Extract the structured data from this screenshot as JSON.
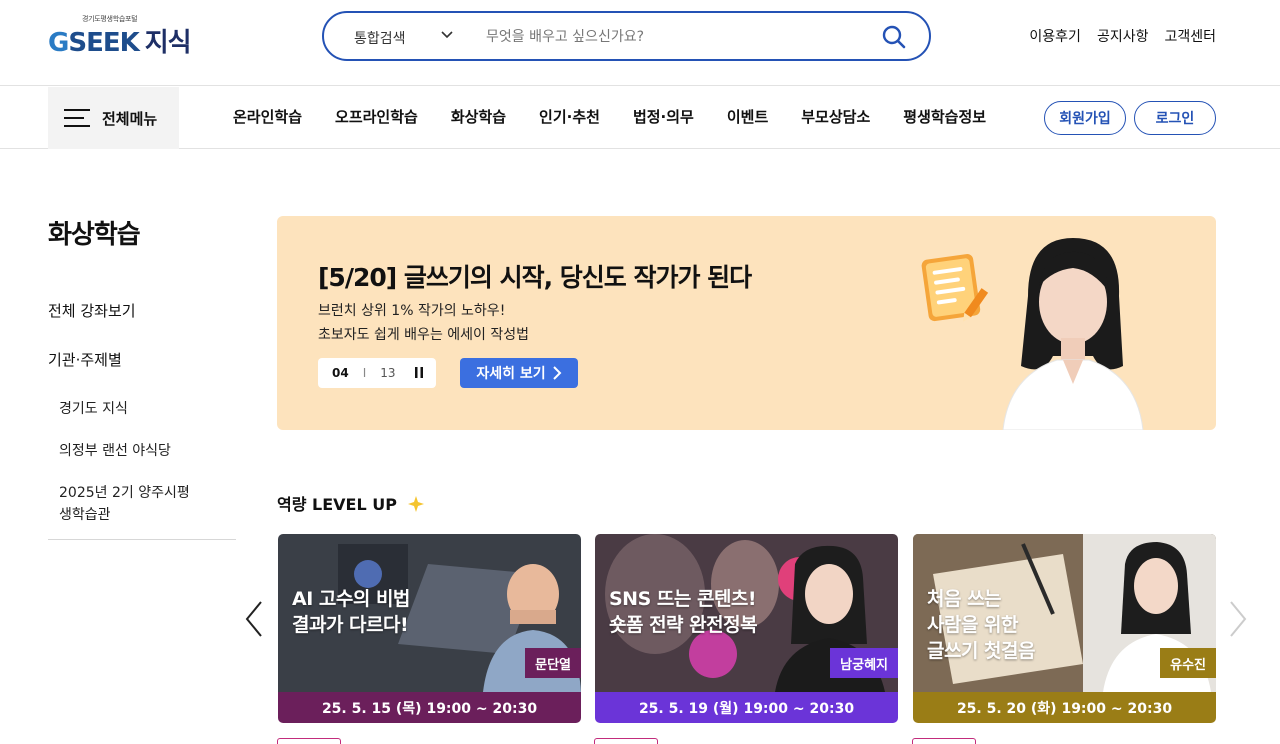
{
  "header": {
    "logo_tagline": "경기도평생학습포털",
    "logo_g": "G",
    "logo_seek": "SEEK",
    "logo_jisik": "지식",
    "search_scope": "통합검색",
    "search_placeholder": "무엇을 배우고 싶으신가요?",
    "utils": [
      "이용후기",
      "공지사항",
      "고객센터"
    ]
  },
  "nav": {
    "all_menu_label": "전체메뉴",
    "items": [
      "온라인학습",
      "오프라인학습",
      "화상학습",
      "인기·추천",
      "법정·의무",
      "이벤트",
      "부모상담소",
      "평생학습정보"
    ],
    "join_label": "회원가입",
    "login_label": "로그인"
  },
  "sidebar": {
    "page_title": "화상학습",
    "all_courses": "전체 강좌보기",
    "by_org": "기관·주제별",
    "orgs": [
      "경기도 지식",
      "의정부 랜선 야식당",
      "2025년 2기 양주시평\n생학습관"
    ]
  },
  "banner": {
    "title": "[5/20] 글쓰기의 시작, 당신도 작가가 된다",
    "desc1": "브런치 상위 1% 작가의 노하우!",
    "desc2": "초보자도 쉽게 배우는 에세이 작성법",
    "current": "04",
    "separator": "I",
    "total": "13",
    "more_label": "자세히 보기"
  },
  "section": {
    "title": "역량 LEVEL UP",
    "cards": [
      {
        "title": "AI 고수의 비법\n결과가 다르다!",
        "name": "문단열",
        "date": "25. 5. 15 (목) 19:00 ~ 20:30",
        "color": "#6b1f5b"
      },
      {
        "title": "SNS 뜨는 콘텐츠!\n숏폼 전략 완전정복",
        "name": "남궁혜지",
        "date": "25. 5. 19 (월) 19:00 ~ 20:30",
        "color": "#6b34d8"
      },
      {
        "title": "처음 쓰는\n사람을 위한\n글쓰기 첫걸음",
        "name": "유수진",
        "date": "25. 5. 20 (화) 19:00 ~ 20:30",
        "color": "#9a7d16"
      }
    ]
  },
  "colors": {
    "brand_blue": "#2452b5",
    "banner_bg": "#fde3bd",
    "button_blue": "#3b6fe0"
  }
}
